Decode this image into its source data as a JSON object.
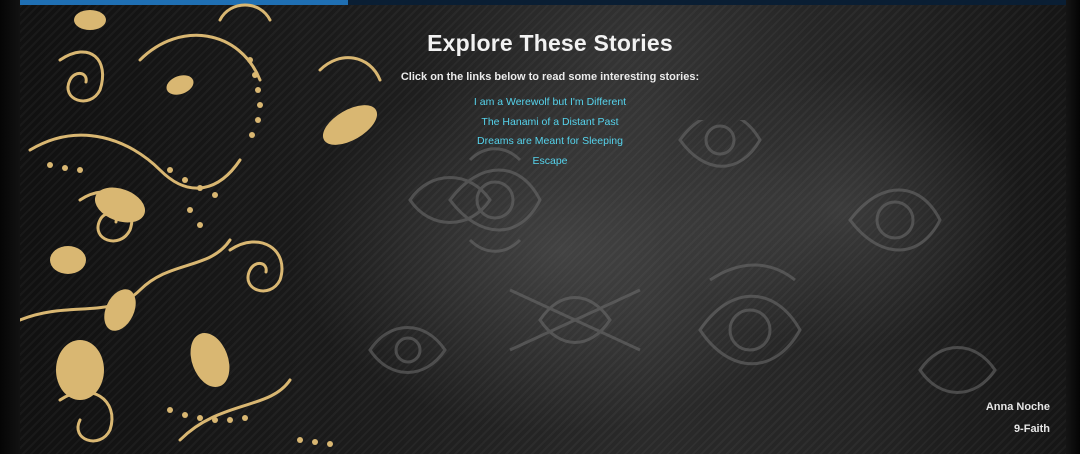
{
  "page": {
    "title": "Explore These Stories",
    "subtitle": "Click on the links below to read some interesting stories:"
  },
  "stories": [
    {
      "label": "I am a Werewolf but I'm Different"
    },
    {
      "label": "The Hanami of a Distant Past"
    },
    {
      "label": "Dreams are Meant for Sleeping"
    },
    {
      "label": "Escape"
    }
  ],
  "author": {
    "name": "Anna Noche",
    "section": "9-Faith"
  },
  "colors": {
    "link": "#55d3ec",
    "title": "#f2f2f2",
    "ornament_gold": "#d9b772",
    "background": "#1c1c1c"
  }
}
